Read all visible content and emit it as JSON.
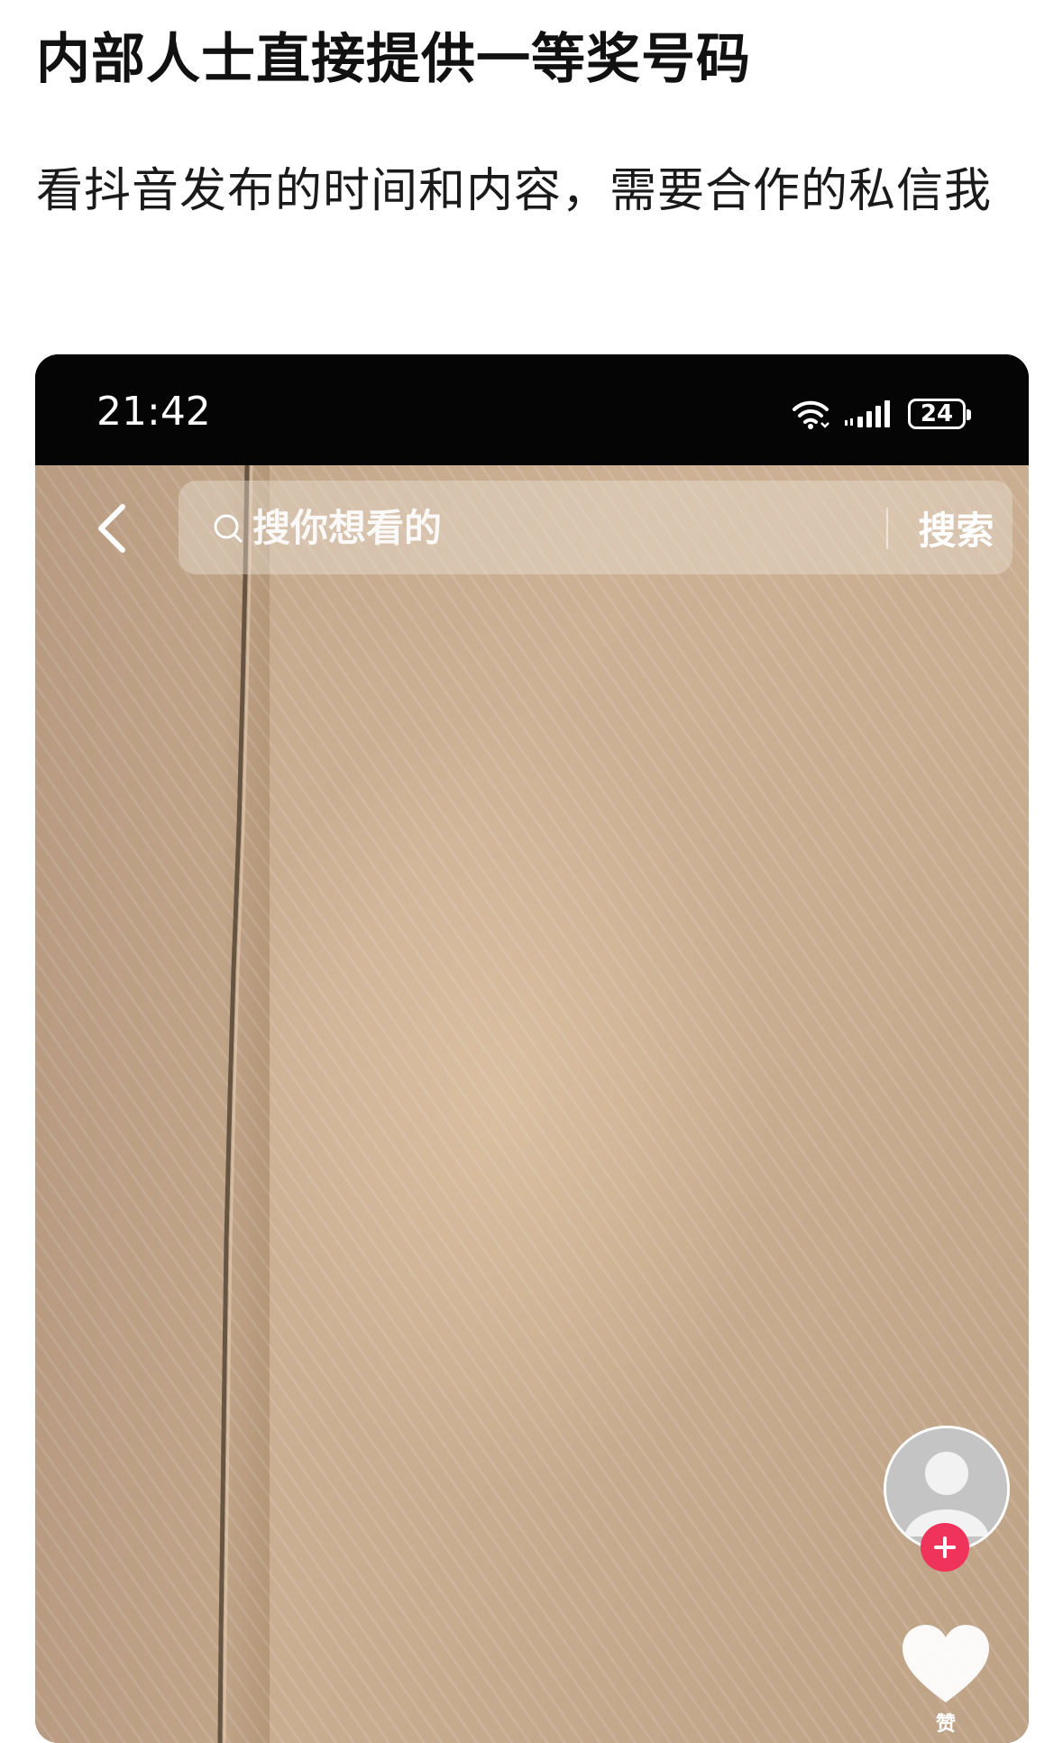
{
  "post": {
    "title": "内部人士直接提供一等奖号码",
    "body": "看抖音发布的时间和内容，需要合作的私信我"
  },
  "phone_screenshot": {
    "status_bar": {
      "time": "21:42",
      "battery_level": "24",
      "icons": [
        "wifi-icon",
        "signal-icon",
        "battery-icon"
      ]
    },
    "app": {
      "back_icon": "chevron-left-icon",
      "search": {
        "placeholder": "搜你想看的",
        "value": "",
        "button_label": "搜索"
      },
      "side_actions": {
        "avatar_icon": "user-avatar-icon",
        "follow_icon": "plus-icon",
        "like_icon": "heart-icon",
        "like_label": "赞"
      }
    },
    "colors": {
      "status_bar_bg": "#050505",
      "cardboard": "#c9ad90",
      "follow_accent": "#f0335a"
    }
  }
}
